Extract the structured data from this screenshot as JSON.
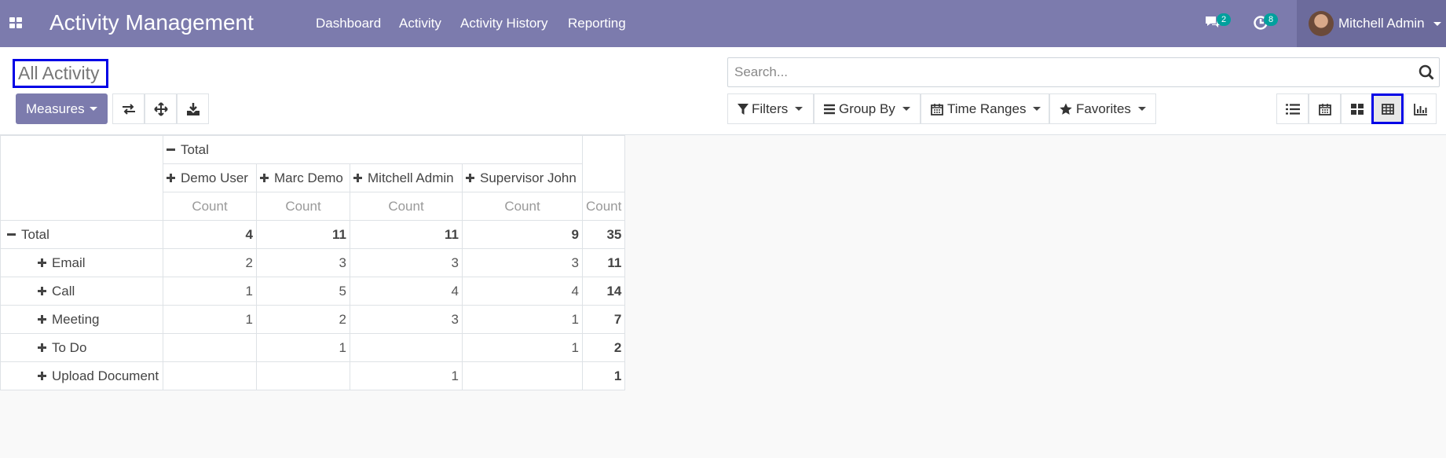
{
  "navbar": {
    "app_title": "Activity Management",
    "menu": [
      "Dashboard",
      "Activity",
      "Activity History",
      "Reporting"
    ],
    "messages_badge": "2",
    "activities_badge": "8",
    "user_name": "Mitchell Admin"
  },
  "control": {
    "title": "All Activity",
    "measures_label": "Measures",
    "search_placeholder": "Search...",
    "filters_label": "Filters",
    "groupby_label": "Group By",
    "timeranges_label": "Time Ranges",
    "favorites_label": "Favorites"
  },
  "pivot": {
    "col_total_label": "Total",
    "columns": [
      "Demo User",
      "Marc Demo",
      "Mitchell Admin",
      "Supervisor John"
    ],
    "measure_label": "Count",
    "total_row": {
      "label": "Total",
      "values": [
        "4",
        "11",
        "11",
        "9"
      ],
      "total": "35"
    },
    "rows": [
      {
        "label": "Email",
        "values": [
          "2",
          "3",
          "3",
          "3"
        ],
        "total": "11"
      },
      {
        "label": "Call",
        "values": [
          "1",
          "5",
          "4",
          "4"
        ],
        "total": "14"
      },
      {
        "label": "Meeting",
        "values": [
          "1",
          "2",
          "3",
          "1"
        ],
        "total": "7"
      },
      {
        "label": "To Do",
        "values": [
          "",
          "1",
          "",
          "1"
        ],
        "total": "2"
      },
      {
        "label": "Upload Document",
        "values": [
          "",
          "",
          "1",
          ""
        ],
        "total": "1"
      }
    ]
  },
  "colors": {
    "navbar": "#7c7bad",
    "badge": "#00a09d",
    "highlight": "#0000e6"
  }
}
